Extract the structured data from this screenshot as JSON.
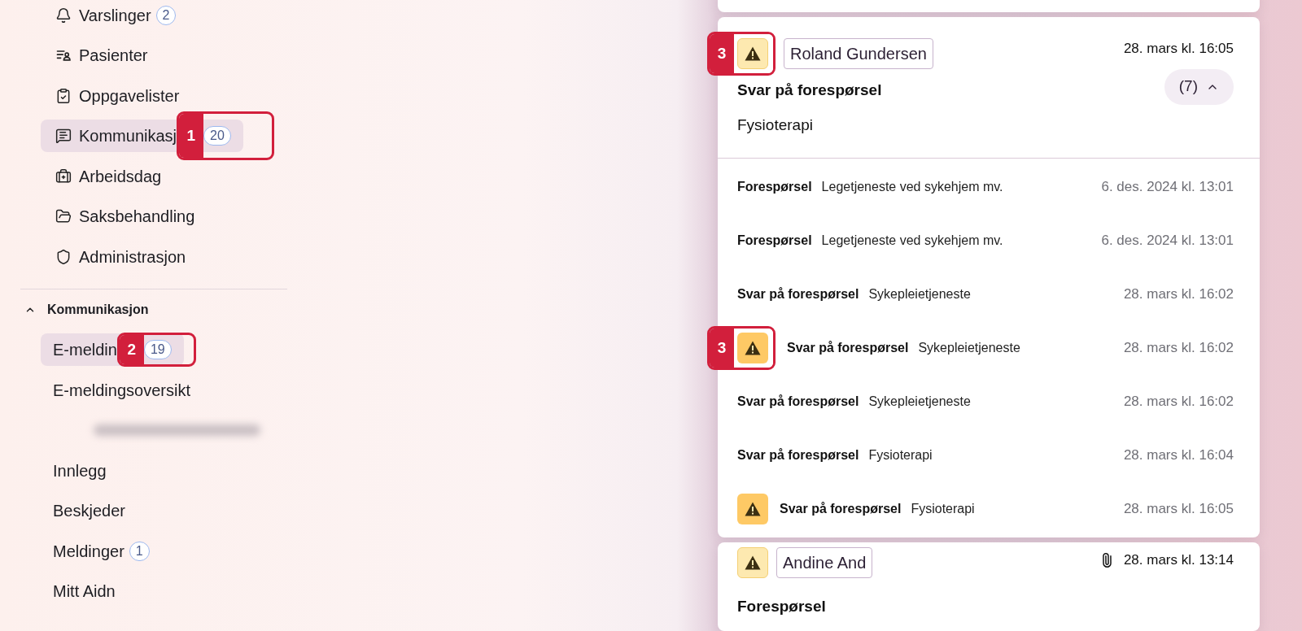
{
  "sidebar": {
    "items": [
      {
        "label": "Varslinger",
        "badge": "2",
        "selected": false
      },
      {
        "label": "Pasienter",
        "selected": false
      },
      {
        "label": "Oppgavelister",
        "selected": false
      },
      {
        "label": "Kommunikasj",
        "badge": "20",
        "selected": true,
        "callout": "1"
      },
      {
        "label": "Arbeidsdag",
        "selected": false
      },
      {
        "label": "Saksbehandling",
        "selected": false
      },
      {
        "label": "Administrasjon",
        "selected": false
      }
    ],
    "section": {
      "title": "Kommunikasjon",
      "expanded": true,
      "items": [
        {
          "kind": "link",
          "label": "E-meldin",
          "badge": "19",
          "selected": true,
          "callout": "2"
        },
        {
          "kind": "link",
          "label": "E-meldingsoversikt",
          "selected": false
        },
        {
          "kind": "redacted"
        },
        {
          "kind": "link",
          "label": "Innlegg",
          "selected": false
        },
        {
          "kind": "link",
          "label": "Beskjeder",
          "selected": false
        },
        {
          "kind": "link",
          "label": "Meldinger",
          "badge": "1",
          "selected": false
        },
        {
          "kind": "link",
          "label": "Mitt Aidn",
          "selected": false
        }
      ]
    }
  },
  "messages": [
    {
      "kind": "cut"
    },
    {
      "kind": "thread",
      "warning": true,
      "callout": "3",
      "sender": "Roland Gundersen",
      "date": "28. mars kl. 16:05",
      "count": "(7)",
      "expanded": true,
      "title": "Svar på forespørsel",
      "subtitle": "Fysioterapi",
      "items": [
        {
          "type": "Forespørsel",
          "service": "Legetjeneste ved sykehjem mv.",
          "date": "6. des. 2024 kl. 13:01",
          "warning": false
        },
        {
          "type": "Forespørsel",
          "service": "Legetjeneste ved sykehjem mv.",
          "date": "6. des. 2024 kl. 13:01",
          "warning": false
        },
        {
          "type": "Svar på forespørsel",
          "service": "Sykepleietjeneste",
          "date": "28. mars kl. 16:02",
          "warning": false
        },
        {
          "type": "Svar på forespørsel",
          "service": "Sykepleietjeneste",
          "date": "28. mars kl. 16:02",
          "warning": true,
          "callout": "3"
        },
        {
          "type": "Svar på forespørsel",
          "service": "Sykepleietjeneste",
          "date": "28. mars kl. 16:02",
          "warning": false
        },
        {
          "type": "Svar på forespørsel",
          "service": "Fysioterapi",
          "date": "28. mars kl. 16:04",
          "warning": false
        },
        {
          "type": "Svar på forespørsel",
          "service": "Fysioterapi",
          "date": "28. mars kl. 16:05",
          "warning": true
        }
      ]
    },
    {
      "kind": "single",
      "warning": true,
      "sender": "Andine And",
      "date": "28. mars kl. 13:14",
      "title": "Forespørsel",
      "attachment": true
    }
  ]
}
